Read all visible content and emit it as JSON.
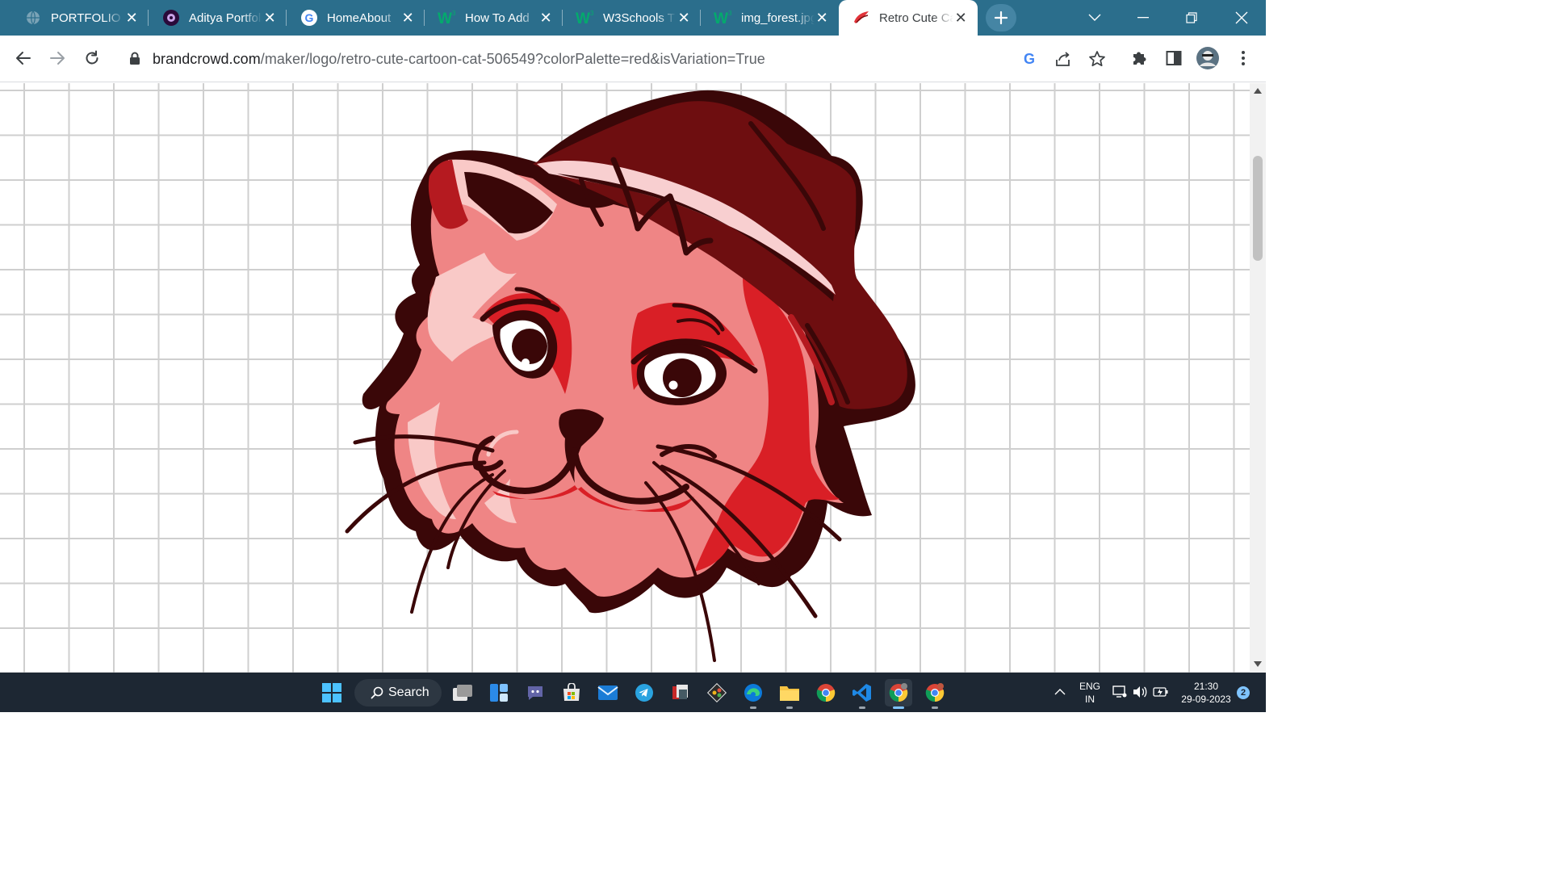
{
  "browser": {
    "tabs": [
      {
        "title": "PORTFOLIO",
        "favicon": "globe-icon",
        "active": false
      },
      {
        "title": "Aditya Portfolio",
        "favicon": "portfolio-logo-icon",
        "active": false
      },
      {
        "title": "HomeAbout",
        "favicon": "google-g-icon",
        "active": false
      },
      {
        "title": "How To Add",
        "favicon": "w3schools-icon",
        "active": false
      },
      {
        "title": "W3Schools T",
        "favicon": "w3schools-icon",
        "active": false
      },
      {
        "title": "img_forest.jpg",
        "favicon": "w3schools-icon",
        "active": false
      },
      {
        "title": "Retro Cute Cartoon Cat",
        "favicon": "brandcrowd-icon",
        "active": true
      }
    ],
    "url": {
      "host": "brandcrowd.com",
      "path": "/maker/logo/retro-cute-cartoon-cat-506549?colorPalette=red&isVariation=True"
    }
  },
  "page": {
    "logo_palette": {
      "hat_dark": "#6e0e10",
      "hat_band": "#f8cfd0",
      "fur_main": "#ef8585",
      "fur_shadow": "#d91f26",
      "fur_light": "#f9c9c7",
      "outline": "#3a0708"
    }
  },
  "taskbar": {
    "search_label": "Search",
    "apps": [
      "windows-start-icon",
      "task-view-icon",
      "widgets-icon",
      "teams-chat-icon",
      "store-icon",
      "mail-icon",
      "telegram-icon",
      "files-app-icon",
      "git-icon",
      "edge-icon",
      "file-explorer-icon",
      "chrome-icon",
      "vscode-icon",
      "chrome-profile-icon",
      "chrome-profile2-icon"
    ],
    "language_line1": "ENG",
    "language_line2": "IN",
    "time": "21:30",
    "date": "29-09-2023",
    "notification_count": "2"
  }
}
